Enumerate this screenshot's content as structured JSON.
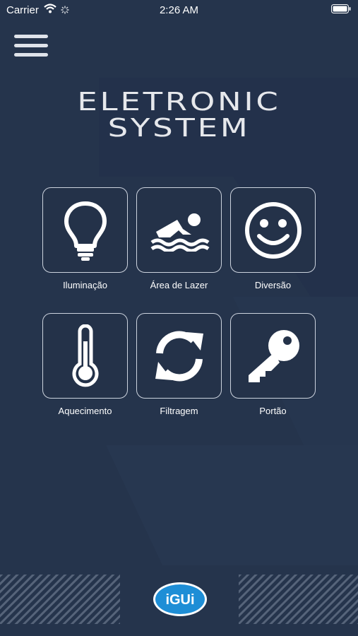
{
  "status_bar": {
    "carrier": "Carrier",
    "time": "2:26 AM",
    "icons": [
      "wifi-icon",
      "activity-spinner-icon",
      "battery-icon"
    ]
  },
  "header": {
    "menu_icon": "hamburger-menu-icon",
    "title_line1": "ELETRONIC",
    "title_line2": "SYSTEM"
  },
  "tiles": [
    {
      "label": "Iluminação",
      "icon": "lightbulb-icon"
    },
    {
      "label": "Área de Lazer",
      "icon": "swimmer-icon"
    },
    {
      "label": "Diversão",
      "icon": "smiley-face-icon"
    },
    {
      "label": "Aquecimento",
      "icon": "thermometer-icon"
    },
    {
      "label": "Filtragem",
      "icon": "refresh-arrows-icon"
    },
    {
      "label": "Portão",
      "icon": "key-icon"
    }
  ],
  "footer": {
    "logo_text": "iGUi"
  },
  "colors": {
    "background": "#25344c",
    "tile_border": "#ccd3de",
    "logo_blue": "#1e8ed6"
  }
}
